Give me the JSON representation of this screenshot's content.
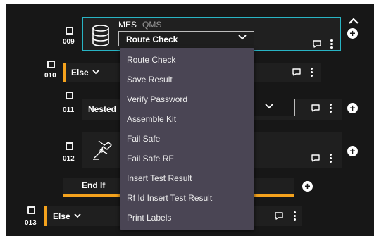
{
  "steps": {
    "s009": {
      "number": "009",
      "tabs": {
        "mes": "MES",
        "qms": "QMS"
      },
      "select_value": "Route Check"
    },
    "s010": {
      "number": "010",
      "label": "Else"
    },
    "s011": {
      "number": "011",
      "label": "Nested"
    },
    "s012": {
      "number": "012"
    },
    "endif": {
      "label": "End If"
    },
    "s013": {
      "number": "013",
      "label": "Else"
    }
  },
  "dropdown": {
    "options": [
      "Route Check",
      "Save Result",
      "Verify Password",
      "Assemble Kit",
      "Fail Safe",
      "Fail Safe RF",
      "Insert Test Result",
      "Rf Id Insert Test Result",
      "Print Labels"
    ]
  },
  "icons": {
    "collapse": "chevron-up-icon",
    "add": "plus-icon",
    "comment": "speech-bubble-icon",
    "menu": "kebab-menu-icon",
    "database": "database-icon",
    "robot": "robot-arm-icon"
  },
  "colors": {
    "background": "#171717",
    "accent_selected": "#28b4c4",
    "branch_bar": "#f4a21d",
    "dropdown_bg": "#4a4554"
  }
}
